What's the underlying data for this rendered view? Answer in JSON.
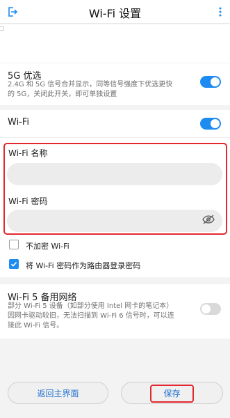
{
  "header": {
    "title": "Wi-Fi 设置",
    "back_icon": "exit-icon",
    "more_icon": "more-vertical-icon"
  },
  "band5g": {
    "title": "5G 优选",
    "desc_line1": "2.4G 和 5G 信号合并显示，同等信号强度下优选更快",
    "desc_line2": "的 5G，关闭此开关，即可单独设置",
    "enabled": true
  },
  "wifi": {
    "title": "Wi-Fi",
    "enabled": true
  },
  "form": {
    "name_label": "Wi-Fi 名称",
    "name_value": "",
    "password_label": "Wi-Fi 密码",
    "password_value": "",
    "visibility_icon": "eye-off-icon"
  },
  "options": {
    "no_encrypt_label": "不加密 Wi-Fi",
    "no_encrypt_checked": false,
    "use_as_login_label": "将 Wi-Fi 密码作为路由器登录密码",
    "use_as_login_checked": true
  },
  "wifi5_backup": {
    "title": "Wi-Fi 5 备用网络",
    "desc_line1": "部分 Wi-Fi 5 设备（如部分使用 Intel 网卡的笔记本）",
    "desc_line2": "因网卡驱动较旧，无法扫描到 Wi-Fi 6 信号时，可以连",
    "desc_line3": "接此 Wi-Fi 信号。",
    "enabled": false
  },
  "footer": {
    "home_label": "返回主界面",
    "save_label": "保存"
  },
  "colors": {
    "accent": "#1d8bf0",
    "highlight": "#e2282e",
    "background": "#f3f3f3"
  }
}
